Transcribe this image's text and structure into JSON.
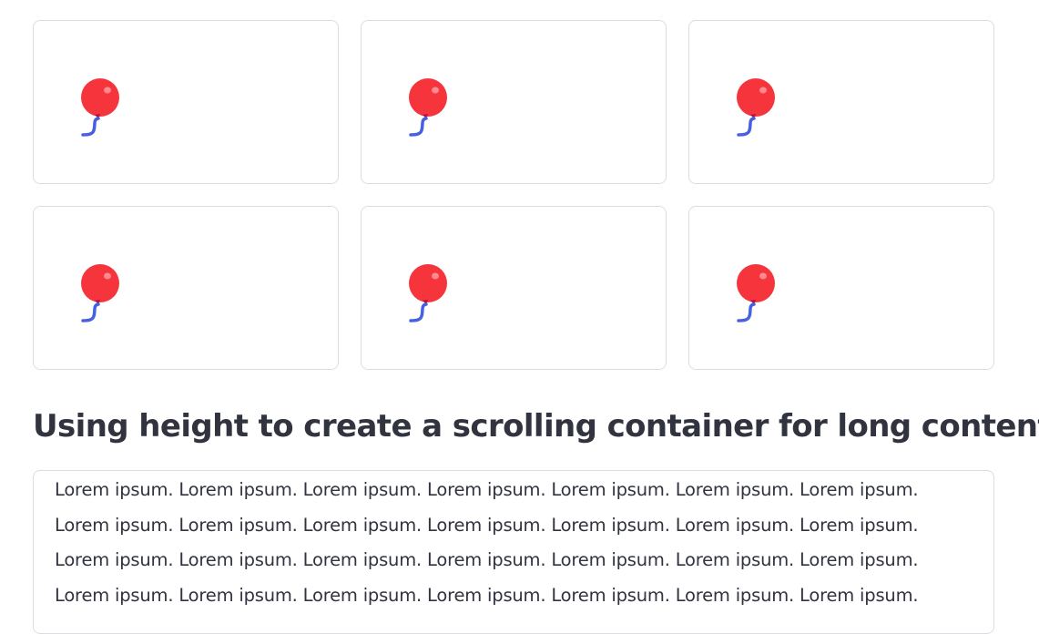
{
  "cards": [
    {
      "icon": "balloon-icon"
    },
    {
      "icon": "balloon-icon"
    },
    {
      "icon": "balloon-icon"
    },
    {
      "icon": "balloon-icon"
    },
    {
      "icon": "balloon-icon"
    },
    {
      "icon": "balloon-icon"
    }
  ],
  "section": {
    "heading": "Using height to create a scrolling container for long content"
  },
  "scroll_container": {
    "text": "Lorem ipsum. Lorem ipsum. Lorem ipsum. Lorem ipsum. Lorem ipsum. Lorem ipsum. Lorem ipsum. Lorem ipsum. Lorem ipsum. Lorem ipsum. Lorem ipsum. Lorem ipsum. Lorem ipsum. Lorem ipsum. Lorem ipsum. Lorem ipsum. Lorem ipsum. Lorem ipsum. Lorem ipsum. Lorem ipsum. Lorem ipsum. Lorem ipsum. Lorem ipsum. Lorem ipsum. Lorem ipsum. Lorem ipsum. Lorem ipsum. Lorem ipsum."
  },
  "colors": {
    "balloon": "#f5343c",
    "balloon_highlight": "#ff8a8e",
    "knot": "#b0124d",
    "string": "#4760e0",
    "border": "#dcdde1",
    "text": "#31333f"
  }
}
